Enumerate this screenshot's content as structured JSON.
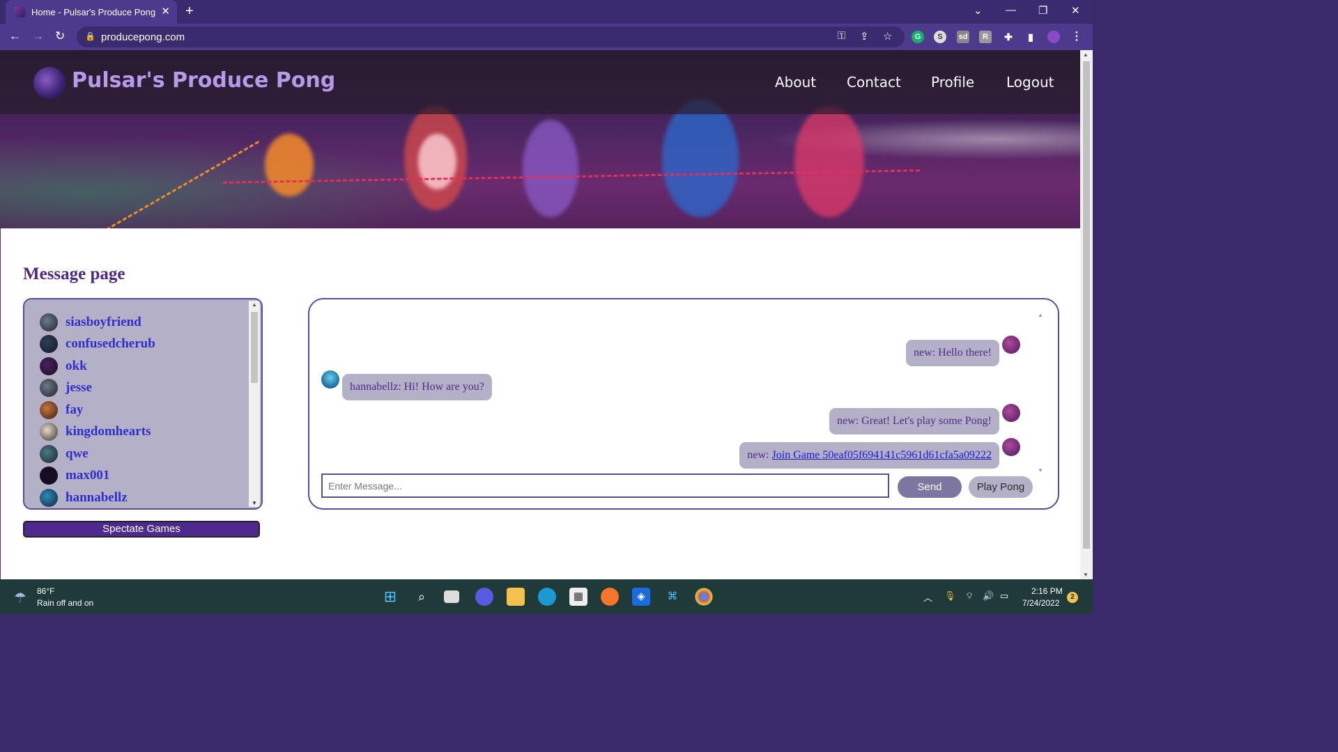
{
  "browser": {
    "tab_title": "Home - Pulsar's Produce Pong",
    "tab_close": "✕",
    "new_tab": "+",
    "url": "producepong.com",
    "back": "←",
    "forward": "→",
    "reload": "↻",
    "minimize": "—",
    "restore": "❐",
    "close": "✕",
    "tab_menu": "⌄"
  },
  "site": {
    "title": "Pulsar's Produce Pong",
    "nav": [
      "About",
      "Contact",
      "Profile",
      "Logout"
    ]
  },
  "page": {
    "heading": "Message page",
    "users": [
      {
        "name": "siasboyfriend",
        "color": "#6b7a8c"
      },
      {
        "name": "confusedcherub",
        "color": "#2a3f5c"
      },
      {
        "name": "okk",
        "color": "#4a1e5e"
      },
      {
        "name": "jesse",
        "color": "#6b7a8c"
      },
      {
        "name": "fay",
        "color": "#c9743a"
      },
      {
        "name": "kingdomhearts",
        "color": "#e8d8c8"
      },
      {
        "name": "qwe",
        "color": "#4a7a8a"
      },
      {
        "name": "max001",
        "color": "#1a0a2a"
      },
      {
        "name": "hannabellz",
        "color": "#2a8ac0"
      }
    ],
    "spectate_label": "Spectate Games",
    "chat": {
      "messages": [
        {
          "sender": "new",
          "text": "new: Hello there!",
          "side": "right"
        },
        {
          "sender": "hannabellz",
          "text": "hannabellz: Hi! How are you?",
          "side": "left"
        },
        {
          "sender": "new",
          "text": "new: Great! Let's play some Pong!",
          "side": "right"
        },
        {
          "sender": "new",
          "prefix": "new: ",
          "link": "Join Game 50eaf05f694141c5961d61cfa5a09222",
          "side": "right"
        }
      ],
      "input_placeholder": "Enter Message...",
      "send_label": "Send",
      "play_label": "Play Pong"
    }
  },
  "taskbar": {
    "weather_temp": "86°F",
    "weather_cond": "Rain off and on",
    "time": "2:16 PM",
    "date": "7/24/2022",
    "notifications": "2"
  },
  "colors": {
    "accent": "#4f2a8e",
    "bubble": "#b4b0c8",
    "link": "#1a1ad0"
  }
}
